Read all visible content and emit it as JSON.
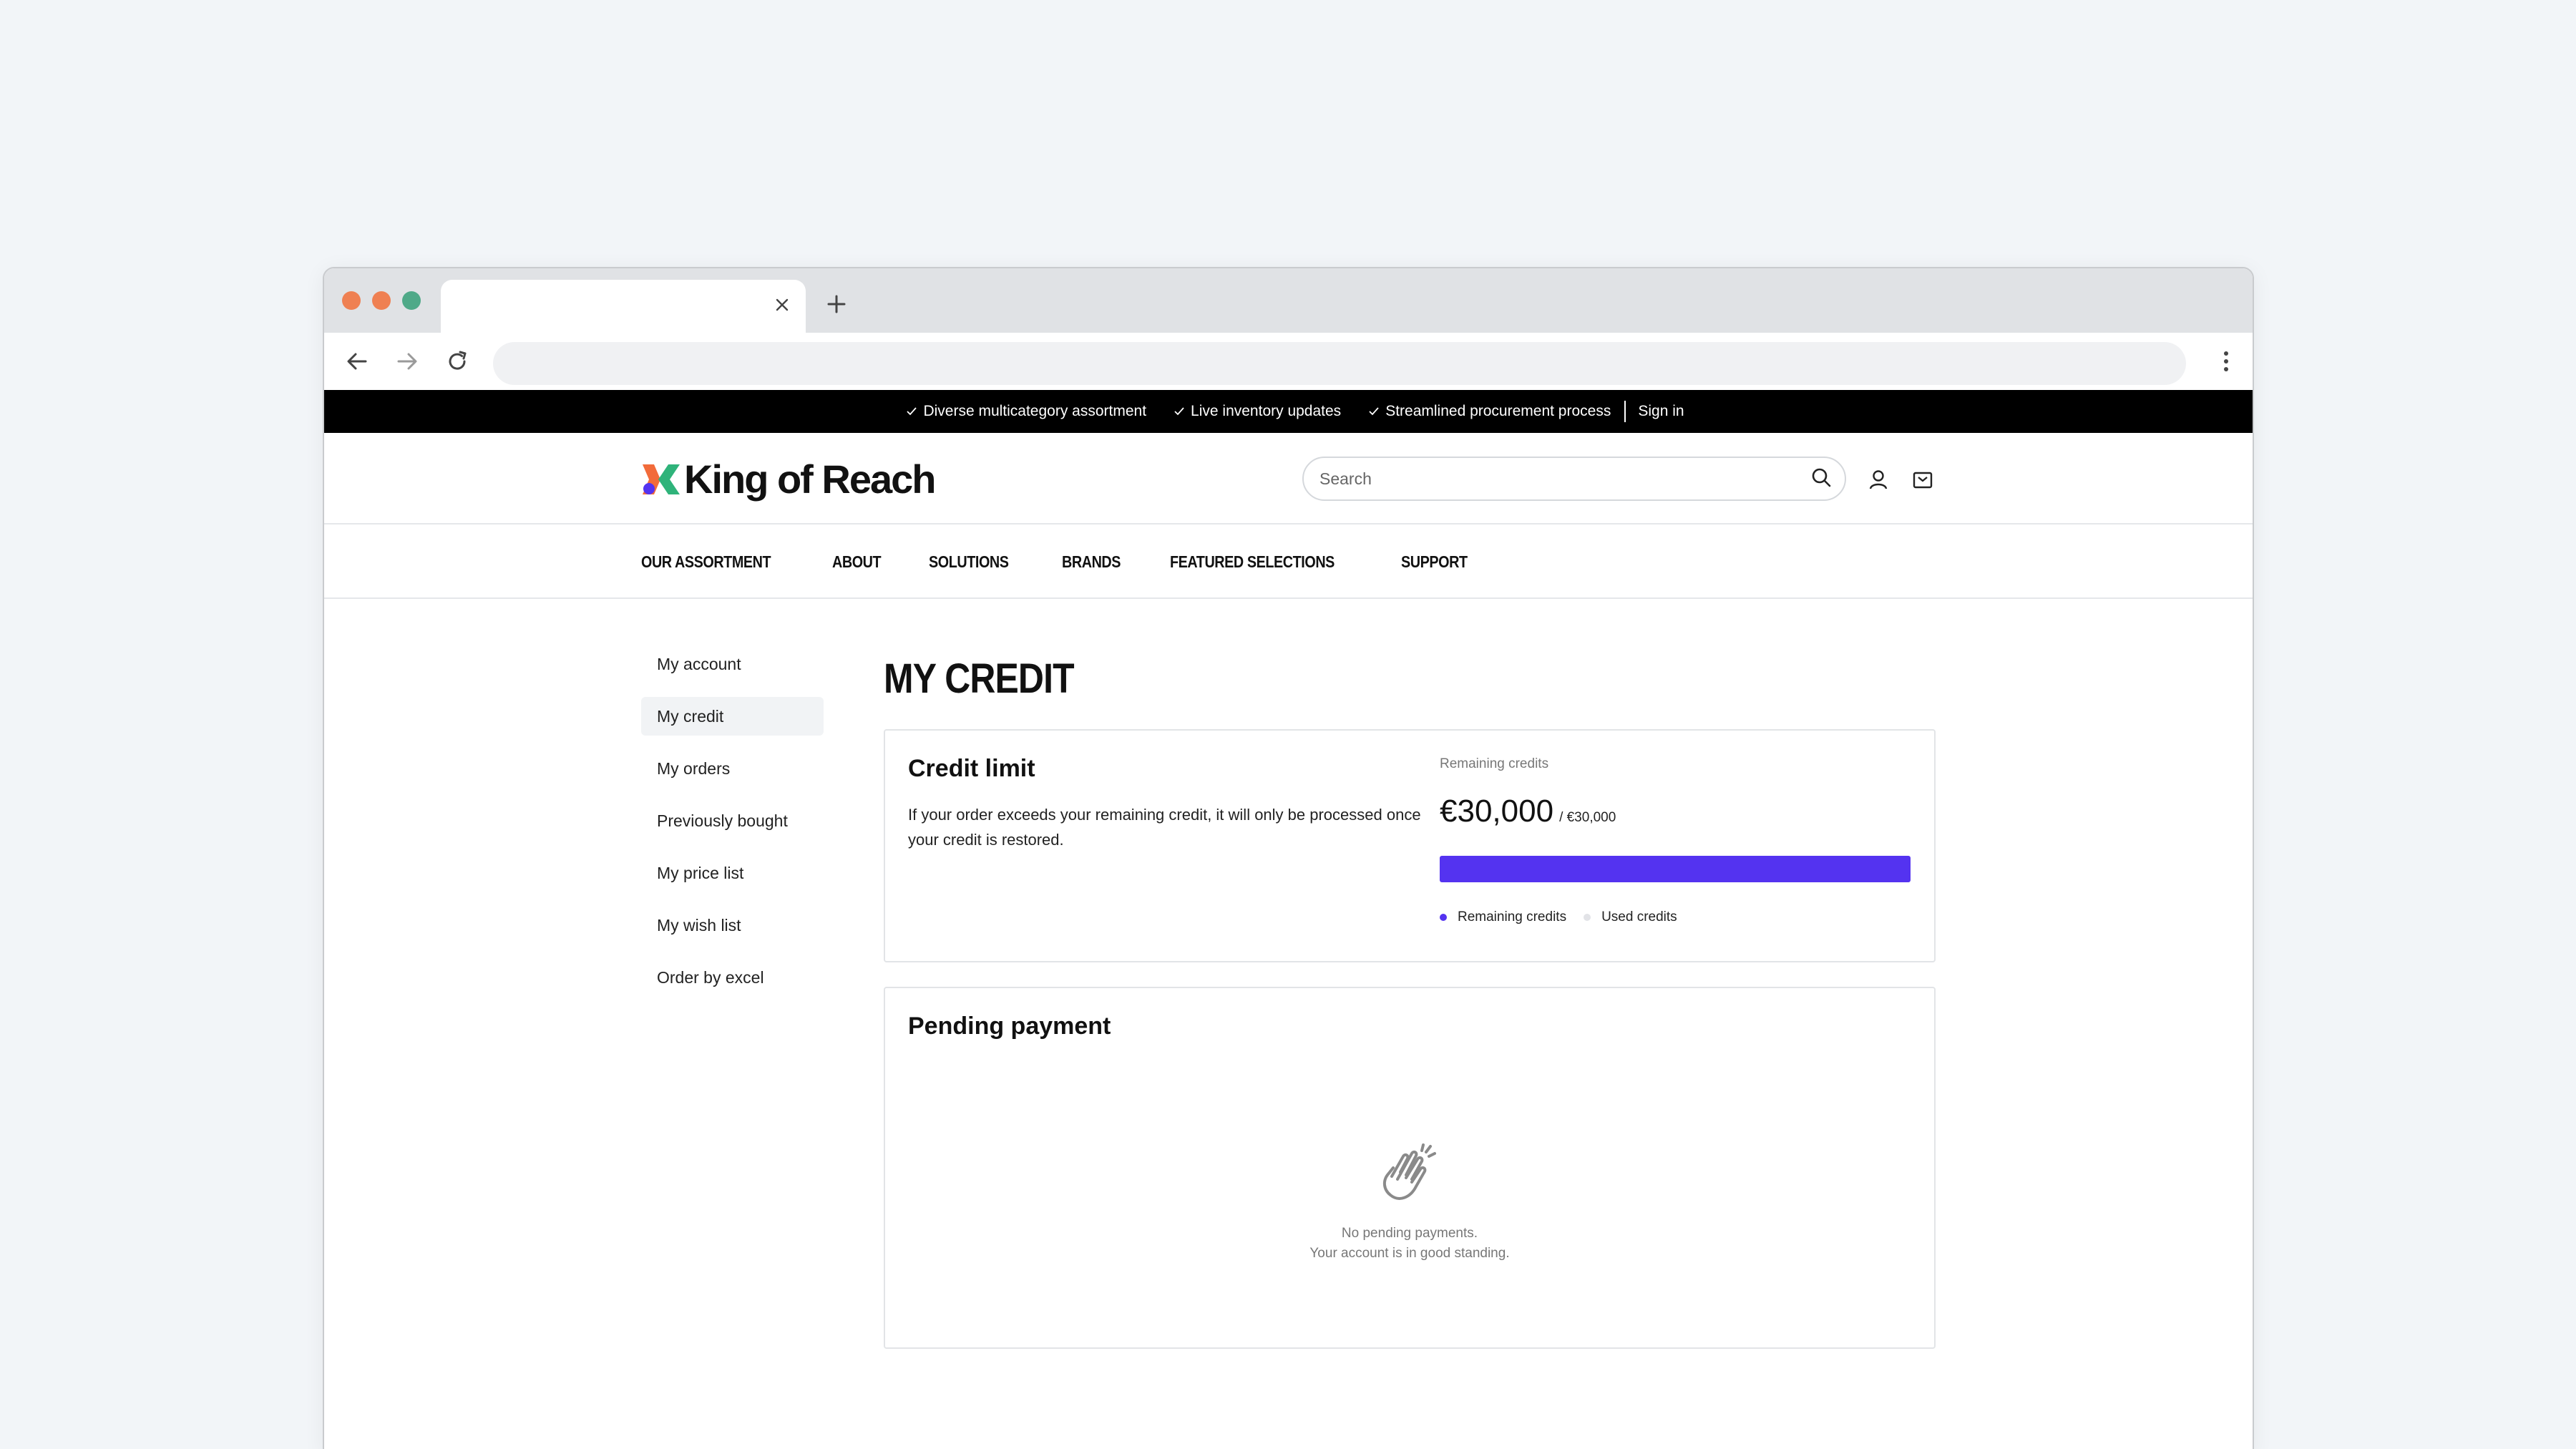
{
  "browser": {
    "tab_title": "",
    "address": ""
  },
  "promo": {
    "items": [
      "Diverse multicategory assortment",
      "Live inventory updates",
      "Streamlined procurement process"
    ],
    "sign_in": "Sign in"
  },
  "header": {
    "brand": "King of Reach",
    "search_placeholder": "Search"
  },
  "nav": {
    "items": [
      "OUR ASSORTMENT",
      "ABOUT",
      "SOLUTIONS",
      "BRANDS",
      "FEATURED SELECTIONS",
      "SUPPORT"
    ]
  },
  "sidebar": {
    "items": [
      "My account",
      "My credit",
      "My orders",
      "Previously bought",
      "My price list",
      "My wish list",
      "Order by excel"
    ],
    "active": "My credit"
  },
  "main": {
    "title": "MY CREDIT",
    "credit": {
      "title": "Credit limit",
      "description": "If your order exceeds your remaining credit, it will only be processed once your credit is restored.",
      "remaining_label": "Remaining credits",
      "remaining_amount": "€30,000",
      "limit_amount": "/ €30,000",
      "remaining_fraction": 1.0,
      "legend_remaining": "Remaining credits",
      "legend_used": "Used credits"
    },
    "pending": {
      "title": "Pending payment",
      "empty_line1": "No pending payments.",
      "empty_line2": "Your account is in good standing."
    }
  },
  "colors": {
    "accent": "#5433f0",
    "traffic_red": "#ef8052",
    "traffic_yellow": "#ef8052",
    "traffic_green": "#4fa988",
    "logo_orange": "#f26b3a",
    "logo_blue": "#5433f0",
    "logo_green": "#2fb37a"
  }
}
